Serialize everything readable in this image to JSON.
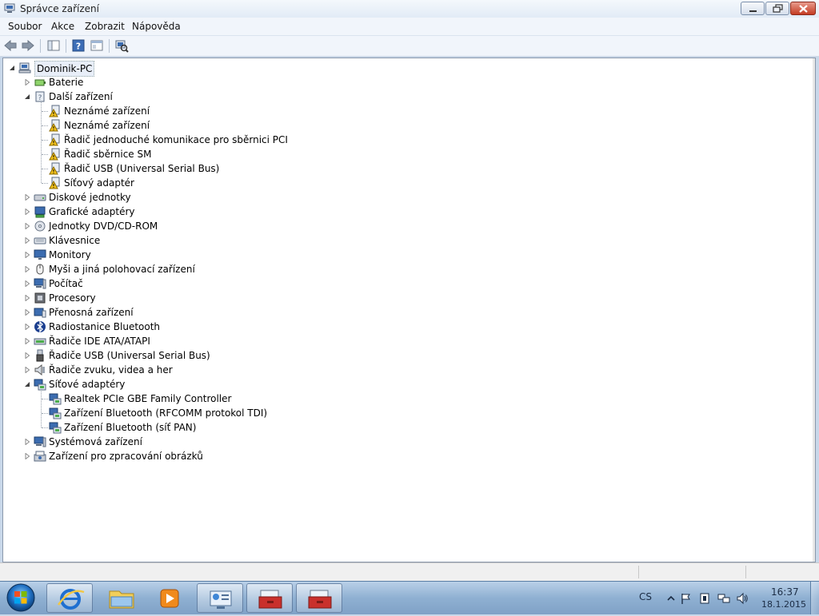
{
  "window": {
    "title": "Správce zařízení"
  },
  "menu": [
    "Soubor",
    "Akce",
    "Zobrazit",
    "Nápověda"
  ],
  "toolbar": {
    "icons": [
      "back-arrow-icon",
      "forward-arrow-icon",
      "console-tree-icon",
      "help-icon",
      "properties-icon",
      "scan-hardware-icon"
    ]
  },
  "tree": {
    "root": "Dominik-PC",
    "items": [
      {
        "label": "Baterie",
        "level": 1,
        "state": "collapsed",
        "icon": "battery-icon"
      },
      {
        "label": "Další zařízení",
        "level": 1,
        "state": "expanded",
        "icon": "unknown-device-icon"
      },
      {
        "label": "Neznámé zařízení",
        "level": 2,
        "icon": "warning-device-icon"
      },
      {
        "label": "Neznámé zařízení",
        "level": 2,
        "icon": "warning-device-icon"
      },
      {
        "label": "Řadič jednoduché komunikace pro sběrnici PCI",
        "level": 2,
        "icon": "warning-device-icon"
      },
      {
        "label": "Řadič sběrnice SM",
        "level": 2,
        "icon": "warning-device-icon"
      },
      {
        "label": "Řadič USB (Universal Serial Bus)",
        "level": 2,
        "icon": "warning-device-icon"
      },
      {
        "label": "Síťový adaptér",
        "level": 2,
        "icon": "warning-device-icon"
      },
      {
        "label": "Diskové jednotky",
        "level": 1,
        "state": "collapsed",
        "icon": "disk-drive-icon"
      },
      {
        "label": "Grafické adaptéry",
        "level": 1,
        "state": "collapsed",
        "icon": "display-adapter-icon"
      },
      {
        "label": "Jednotky DVD/CD-ROM",
        "level": 1,
        "state": "collapsed",
        "icon": "dvd-drive-icon"
      },
      {
        "label": "Klávesnice",
        "level": 1,
        "state": "collapsed",
        "icon": "keyboard-icon"
      },
      {
        "label": "Monitory",
        "level": 1,
        "state": "collapsed",
        "icon": "monitor-icon"
      },
      {
        "label": "Myši a jiná polohovací zařízení",
        "level": 1,
        "state": "collapsed",
        "icon": "mouse-icon"
      },
      {
        "label": "Počítač",
        "level": 1,
        "state": "collapsed",
        "icon": "computer-icon"
      },
      {
        "label": "Procesory",
        "level": 1,
        "state": "collapsed",
        "icon": "processor-icon"
      },
      {
        "label": "Přenosná zařízení",
        "level": 1,
        "state": "collapsed",
        "icon": "portable-device-icon"
      },
      {
        "label": "Radiostanice Bluetooth",
        "level": 1,
        "state": "collapsed",
        "icon": "bluetooth-icon"
      },
      {
        "label": "Řadiče IDE ATA/ATAPI",
        "level": 1,
        "state": "collapsed",
        "icon": "ide-controller-icon"
      },
      {
        "label": "Řadiče USB (Universal Serial Bus)",
        "level": 1,
        "state": "collapsed",
        "icon": "usb-icon"
      },
      {
        "label": "Řadiče zvuku, videa a her",
        "level": 1,
        "state": "collapsed",
        "icon": "speaker-icon"
      },
      {
        "label": "Síťové adaptéry",
        "level": 1,
        "state": "expanded",
        "icon": "network-adapter-icon"
      },
      {
        "label": "Realtek PCIe GBE Family Controller",
        "level": 2,
        "icon": "network-adapter-icon"
      },
      {
        "label": "Zařízení Bluetooth (RFCOMM protokol TDI)",
        "level": 2,
        "icon": "network-adapter-icon"
      },
      {
        "label": "Zařízení Bluetooth (síť PAN)",
        "level": 2,
        "icon": "network-adapter-icon"
      },
      {
        "label": "Systémová zařízení",
        "level": 1,
        "state": "collapsed",
        "icon": "system-device-icon"
      },
      {
        "label": "Zařízení pro zpracování obrázků",
        "level": 1,
        "state": "collapsed",
        "icon": "imaging-device-icon"
      }
    ]
  },
  "taskbar": {
    "buttons": [
      "internet-explorer-icon",
      "file-explorer-icon",
      "media-player-icon",
      "control-panel-icon",
      "toolbox-icon",
      "toolbox-icon"
    ],
    "language": "CS",
    "time": "16:37",
    "date": "18.1.2015"
  },
  "colors": {
    "title_bg": "#e2ebf6",
    "taskbar": "#8fb0d2",
    "close_button": "#c43b22",
    "warning": "#f3c21b"
  }
}
